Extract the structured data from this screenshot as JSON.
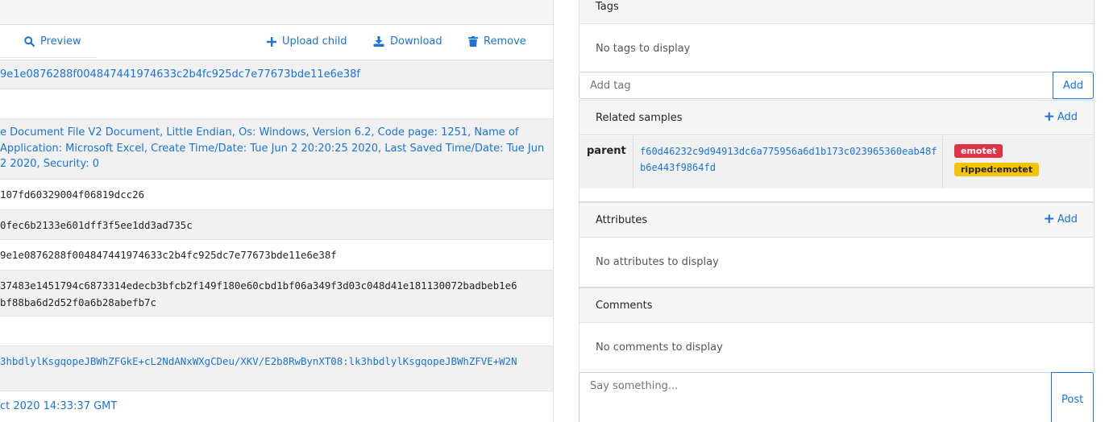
{
  "toolbar": {
    "preview": "Preview",
    "upload_child": "Upload child",
    "download": "Download",
    "remove": "Remove"
  },
  "rows": {
    "md5_link": "9e1e0876288f004847441974633c2b4fc925dc7e77673bde11e6e38f",
    "type_line1": "e Document File V2 Document, Little Endian, Os: Windows, Version 6.2, Code page: 1251, Name of",
    "type_line2": "Application: Microsoft Excel, Create Time/Date: Tue Jun 2 20:20:25 2020, Last Saved Time/Date: Tue Jun",
    "type_line3": "2 2020, Security: 0",
    "hash1": "107fd60329004f06819dcc26",
    "hash2": "0fec6b2133e601dff3f5ee1dd3ad735c",
    "hash3": "9e1e0876288f004847441974633c2b4fc925dc7e77673bde11e6e38f",
    "hash4_line1": "37483e1451794c6873314edecb3bfcb2f149f180e60cbd1bf06a349f3d03c048d41e181130072badbeb1e6",
    "hash4_line2": "bf88ba6d2d52f0a6b28abefb7c",
    "ssdeep": "3hbdlylKsgqopeJBWhZFGkE+cL2NdANxWXgCDeu/XKV/E2b8RwBynXT08:lk3hbdlylKsgqopeJBWhZFVE+W2N",
    "date": "ct 2020 14:33:37 GMT"
  },
  "tags": {
    "title": "Tags",
    "empty": "No tags to display",
    "placeholder": "Add tag",
    "add_button": "Add"
  },
  "related": {
    "title": "Related samples",
    "add": "Add",
    "relation": "parent",
    "hash": "f60d46232c9d94913dc6a775956a6d1b173c023965360eab48fb6e443f9864fd",
    "badges": [
      "emotet",
      "ripped:emotet"
    ]
  },
  "attributes": {
    "title": "Attributes",
    "add": "Add",
    "empty": "No attributes to display"
  },
  "comments": {
    "title": "Comments",
    "empty": "No comments to display",
    "placeholder": "Say something...",
    "post_button": "Post"
  },
  "colors": {
    "link": "#1a73d8",
    "danger": "#dc3545",
    "warning": "#f5c400"
  }
}
